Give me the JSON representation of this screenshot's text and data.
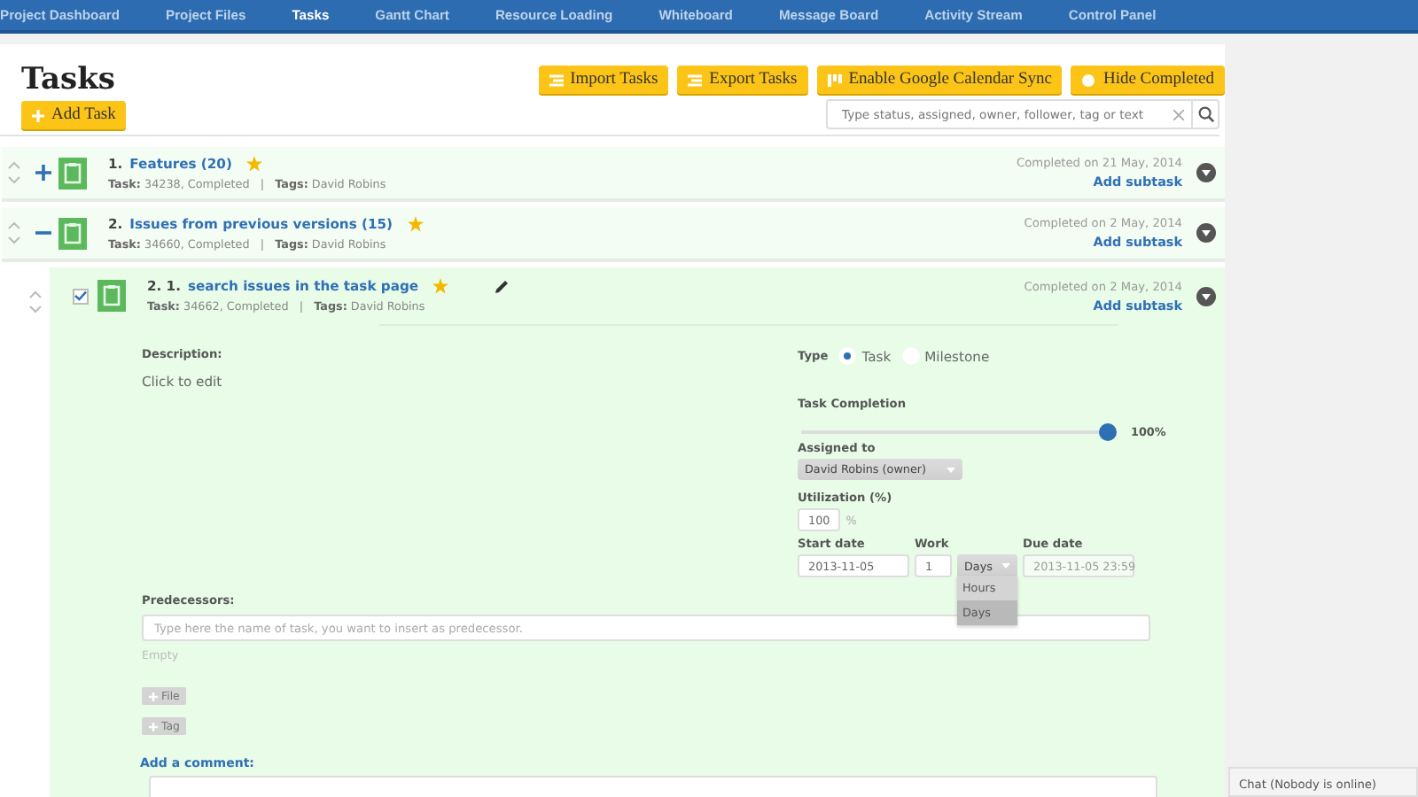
{
  "nav": {
    "items": [
      {
        "label": "Project Dashboard",
        "selected": false
      },
      {
        "label": "Project Files",
        "selected": false
      },
      {
        "label": "Tasks",
        "selected": true
      },
      {
        "label": "Gantt Chart",
        "selected": false
      },
      {
        "label": "Resource Loading",
        "selected": false
      },
      {
        "label": "Whiteboard",
        "selected": false
      },
      {
        "label": "Message Board",
        "selected": false
      },
      {
        "label": "Activity Stream",
        "selected": false
      },
      {
        "label": "Control Panel",
        "selected": false
      }
    ]
  },
  "page": {
    "title": "Tasks",
    "add_task": "Add Task",
    "actions": [
      "Import Tasks",
      "Export Tasks",
      "Enable Google Calendar Sync",
      "Hide Completed"
    ],
    "search": {
      "placeholder": "Type status, assigned, owner, follower, tag or text"
    }
  },
  "tasks": [
    {
      "number": "1.",
      "title": "Features (20)",
      "starred": true,
      "expanded": false,
      "meta": "**Task:** 34238, Completed   |   **Tags:** David Robins",
      "completed": "Completed on 21 May, 2014",
      "add_subtask": "Add subtask"
    },
    {
      "number": "2.",
      "title": "Issues from previous versions (15)",
      "starred": true,
      "expanded": true,
      "meta": "**Task:** 34660, Completed   |   **Tags:** David Robins",
      "completed": "Completed on 2 May, 2014",
      "add_subtask": "Add subtask",
      "children": [
        {
          "number": "2. 1.",
          "title": "search issues in the task page",
          "starred": true,
          "checked": true,
          "meta": "**Task:** 34662, Completed   |   **Tags:** David Robins",
          "completed": "Completed on 2 May, 2014",
          "add_subtask": "Add subtask",
          "details": {
            "description_label": "Description:",
            "description": "Click to edit",
            "type_label": "Type",
            "type_options": [
              {
                "label": "Task",
                "selected": true
              },
              {
                "label": "Milestone",
                "selected": false
              }
            ],
            "completion_label": "Task Completion",
            "completion": {
              "level": 1,
              "reading": "100%"
            },
            "assigned_label": "Assigned to",
            "assigned": "David Robins (owner)",
            "utilization_label": "Utilization (%)",
            "utilization": "100",
            "utilization_unit": "%",
            "start_label": "Start date",
            "start": "2013-11-05",
            "work_label": "Work",
            "work": "1",
            "work_unit": {
              "value": "Days",
              "open": true,
              "options": [
                {
                  "label": "Hours",
                  "selected": false
                },
                {
                  "label": "Days",
                  "selected": true
                }
              ]
            },
            "due_label": "Due date",
            "due": "2013-11-05 23:59",
            "due_disabled": true,
            "predecessors_label": "Predecessors:",
            "predecessors_placeholder": "Type here the name of task, you want to insert as predecessor.",
            "predecessors_empty": "Empty",
            "attach_buttons": [
              "File",
              "Tag"
            ],
            "comment_label": "Add a comment:"
          }
        }
      ]
    }
  ],
  "chat": {
    "label": "Chat (Nobody is online)"
  }
}
